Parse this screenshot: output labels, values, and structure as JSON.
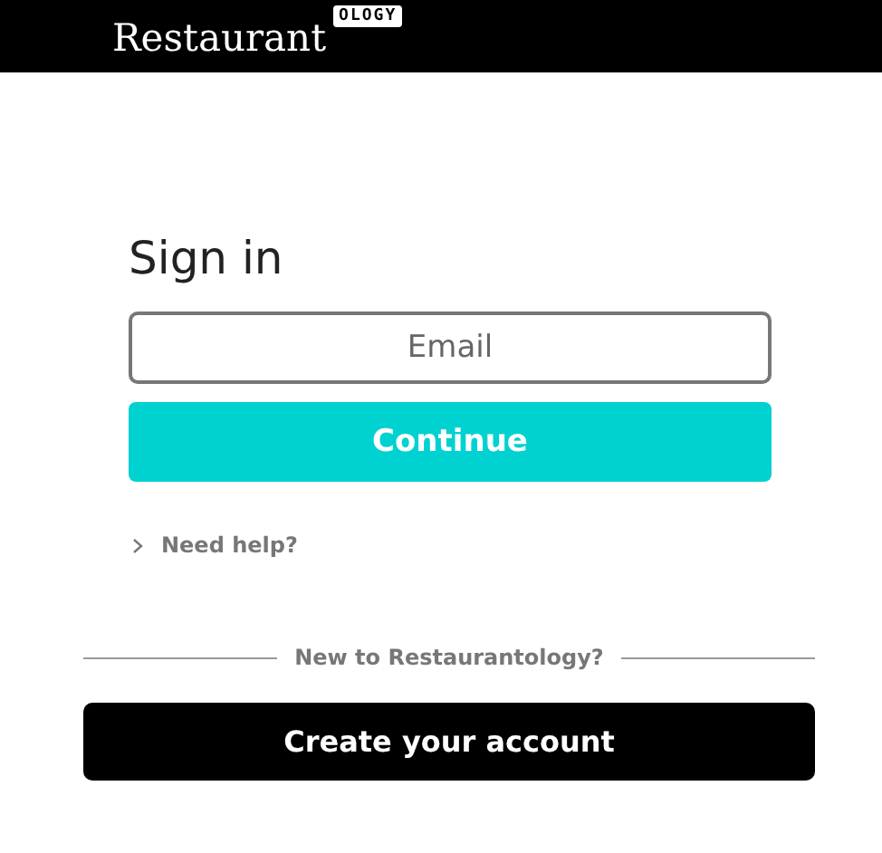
{
  "header": {
    "logo_text": "Restaurant",
    "logo_badge": "OLOGY"
  },
  "signin": {
    "title": "Sign in",
    "email": {
      "placeholder": "Email"
    },
    "continue_button": "Continue",
    "help_link": "Need help?"
  },
  "signup": {
    "divider_text": "New to Restaurantology?",
    "create_button": "Create your account"
  }
}
